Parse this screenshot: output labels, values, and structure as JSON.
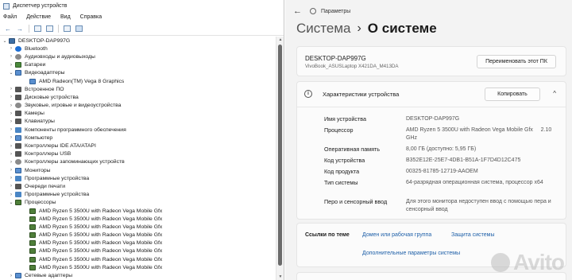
{
  "device_manager": {
    "title": "Диспетчер устройств",
    "menu": [
      "Файл",
      "Действие",
      "Вид",
      "Справка"
    ],
    "toolbar_icons": [
      "back-arrow-icon",
      "forward-arrow-icon",
      "properties-icon",
      "help-icon",
      "scan-icon",
      "monitor-icon"
    ],
    "tree": [
      {
        "label": "DESKTOP-DAP997G",
        "level": 0,
        "expander": "⌄",
        "icon": "computer"
      },
      {
        "label": "Bluetooth",
        "level": 1,
        "expander": "›",
        "icon": "bt"
      },
      {
        "label": "Аудиовходы и аудиовыходы",
        "level": 1,
        "expander": "›",
        "icon": "gear"
      },
      {
        "label": "Батареи",
        "level": 1,
        "expander": "›",
        "icon": "green"
      },
      {
        "label": "Видеоадаптеры",
        "level": 1,
        "expander": "⌄",
        "icon": "monitor"
      },
      {
        "label": "AMD Radeon(TM) Vega 8 Graphics",
        "level": 2,
        "expander": "",
        "icon": "monitor"
      },
      {
        "label": "Встроенное ПО",
        "level": 1,
        "expander": "›",
        "icon": "dark"
      },
      {
        "label": "Дисковые устройства",
        "level": 1,
        "expander": "›",
        "icon": "dark"
      },
      {
        "label": "Звуковые, игровые и видеоустройства",
        "level": 1,
        "expander": "›",
        "icon": "gear"
      },
      {
        "label": "Камеры",
        "level": 1,
        "expander": "›",
        "icon": "dark"
      },
      {
        "label": "Клавиатуры",
        "level": 1,
        "expander": "›",
        "icon": "dark"
      },
      {
        "label": "Компоненты программного обеспечения",
        "level": 1,
        "expander": "›",
        "icon": "blue"
      },
      {
        "label": "Компьютер",
        "level": 1,
        "expander": "›",
        "icon": "monitor"
      },
      {
        "label": "Контроллеры IDE ATA/ATAPI",
        "level": 1,
        "expander": "›",
        "icon": "dark"
      },
      {
        "label": "Контроллеры USB",
        "level": 1,
        "expander": "›",
        "icon": "dark"
      },
      {
        "label": "Контроллеры запоминающих устройств",
        "level": 1,
        "expander": "›",
        "icon": "gear"
      },
      {
        "label": "Мониторы",
        "level": 1,
        "expander": "›",
        "icon": "monitor"
      },
      {
        "label": "Программные устройства",
        "level": 1,
        "expander": "›",
        "icon": "blue"
      },
      {
        "label": "Очереди печати",
        "level": 1,
        "expander": "›",
        "icon": "dark"
      },
      {
        "label": "Программные устройства",
        "level": 1,
        "expander": "›",
        "icon": "blue"
      },
      {
        "label": "Процессоры",
        "level": 1,
        "expander": "⌄",
        "icon": "cpu"
      },
      {
        "label": "AMD Ryzen 5 3500U with Radeon Vega Mobile Gfx",
        "level": 2,
        "expander": "",
        "icon": "cpu"
      },
      {
        "label": "AMD Ryzen 5 3500U with Radeon Vega Mobile Gfx",
        "level": 2,
        "expander": "",
        "icon": "cpu"
      },
      {
        "label": "AMD Ryzen 5 3500U with Radeon Vega Mobile Gfx",
        "level": 2,
        "expander": "",
        "icon": "cpu"
      },
      {
        "label": "AMD Ryzen 5 3500U with Radeon Vega Mobile Gfx",
        "level": 2,
        "expander": "",
        "icon": "cpu"
      },
      {
        "label": "AMD Ryzen 5 3500U with Radeon Vega Mobile Gfx",
        "level": 2,
        "expander": "",
        "icon": "cpu"
      },
      {
        "label": "AMD Ryzen 5 3500U with Radeon Vega Mobile Gfx",
        "level": 2,
        "expander": "",
        "icon": "cpu"
      },
      {
        "label": "AMD Ryzen 5 3500U with Radeon Vega Mobile Gfx",
        "level": 2,
        "expander": "",
        "icon": "cpu"
      },
      {
        "label": "AMD Ryzen 5 3500U with Radeon Vega Mobile Gfx",
        "level": 2,
        "expander": "",
        "icon": "cpu"
      },
      {
        "label": "Сетевые адаптеры",
        "level": 1,
        "expander": "›",
        "icon": "monitor"
      }
    ]
  },
  "settings": {
    "title": "Параметры",
    "back_glyph": "←",
    "breadcrumb": {
      "parent": "Система",
      "separator": "›",
      "current": "О системе"
    },
    "device": {
      "name": "DESKTOP-DAP997G",
      "model": "VivoBook_ASUSLaptop X421DA_M413DA",
      "rename_label": "Переименовать этот ПК"
    },
    "specs": {
      "header": "Характеристики устройства",
      "copy_label": "Копировать",
      "chevron": "^",
      "info_glyph": "i",
      "rows": [
        {
          "key": "Имя устройства",
          "value": "DESKTOP-DAP997G"
        },
        {
          "key": "Процессор",
          "value": "AMD Ryzen 5 3500U with Radeon Vega Mobile Gfx     2.10 GHz"
        },
        {
          "key": "Оперативная память",
          "value": "8,00 ГБ (доступно: 5,95 ГБ)"
        },
        {
          "key": "Код устройства",
          "value": "B352E12E-25E7-4DB1-B51A-1F7D4D12C475"
        },
        {
          "key": "Код продукта",
          "value": "00325-81785-12719-AAOEM"
        },
        {
          "key": "Тип системы",
          "value": "64-разрядная операционная система, процессор x64"
        },
        {
          "key": "Перо и сенсорный ввод",
          "value": "Для этого монитора недоступен ввод с помощью пера и сенсорный ввод"
        }
      ]
    },
    "links": {
      "label": "Ссылки по теме",
      "domain": "Домен или рабочая группа",
      "protection": "Защита системы",
      "advanced": "Дополнительные параметры системы"
    }
  },
  "watermark": "Avito"
}
